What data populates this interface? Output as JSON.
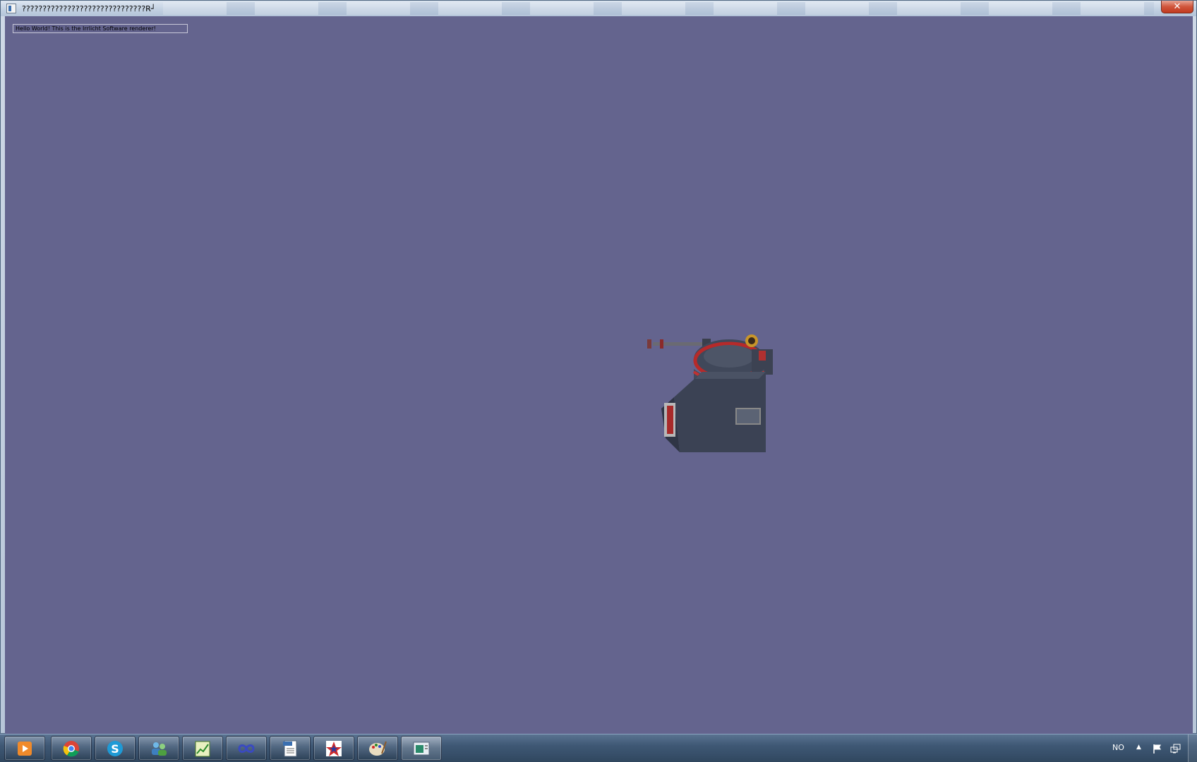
{
  "window": {
    "title": "??????????????????????????????R┘",
    "close_glyph": "✕"
  },
  "scene": {
    "overlay_text": "Hello World! This is the Irrlicht Software renderer!",
    "background_color": "#64648e",
    "model_icon": "turret-model"
  },
  "taskbar": {
    "apps": [
      {
        "name": "media-player-icon"
      },
      {
        "name": "chrome-icon"
      },
      {
        "name": "skype-icon"
      },
      {
        "name": "contacts-icon"
      },
      {
        "name": "chart-app-icon"
      },
      {
        "name": "infinity-app-icon"
      },
      {
        "name": "odf-document-icon"
      },
      {
        "name": "star-app-icon"
      },
      {
        "name": "paint-icon"
      },
      {
        "name": "irrlicht-window-icon"
      }
    ],
    "tray": {
      "language": "NO",
      "chevron": "▲"
    }
  }
}
